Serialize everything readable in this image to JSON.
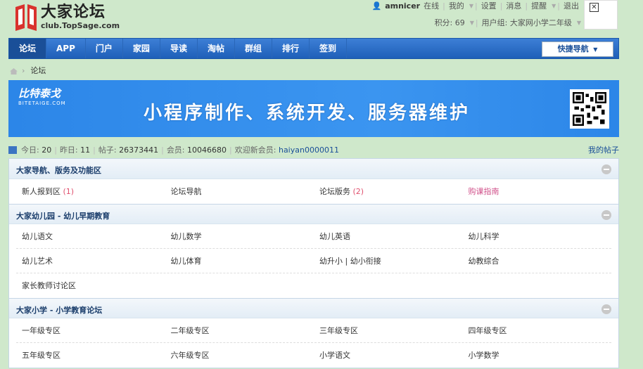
{
  "logo": {
    "title": "大家论坛",
    "subtitle": "club.TopSage.com",
    "color": "#d9322d"
  },
  "user": {
    "name": "amnicer",
    "status": "在线",
    "menu": [
      "我的",
      "设置",
      "消息",
      "提醒",
      "退出"
    ],
    "points_label": "积分: 69",
    "group_label": "用户组: 大家网小学二年级"
  },
  "nav": {
    "items": [
      "论坛",
      "APP",
      "门户",
      "家园",
      "导读",
      "淘帖",
      "群组",
      "排行",
      "签到"
    ],
    "quick_nav": "快捷导航"
  },
  "breadcrumb": {
    "current": "论坛"
  },
  "banner": {
    "logo_text": "比特泰戈",
    "logo_sub": "BITETAIGE.COM",
    "slogan": "小程序制作、系统开发、服务器维护"
  },
  "stats": {
    "today_label": "今日:",
    "today": "20",
    "yesterday_label": "昨日:",
    "yesterday": "11",
    "posts_label": "帖子:",
    "posts": "26373441",
    "members_label": "会员:",
    "members": "10046680",
    "welcome_label": "欢迎新会员:",
    "newest_member": "haiyan0000011",
    "my_posts": "我的帖子"
  },
  "categories": [
    {
      "title": "大家导航、版务及功能区",
      "rows": [
        [
          {
            "name": "新人报到区",
            "count": "(1)"
          },
          {
            "name": "论坛导航",
            "count": ""
          },
          {
            "name": "论坛版务",
            "count": "(2)"
          },
          {
            "name": "购课指南",
            "count": ""
          }
        ]
      ]
    },
    {
      "title": "大家幼儿园 - 幼儿早期教育",
      "rows": [
        [
          {
            "name": "幼儿语文",
            "count": ""
          },
          {
            "name": "幼儿数学",
            "count": ""
          },
          {
            "name": "幼儿英语",
            "count": ""
          },
          {
            "name": "幼儿科学",
            "count": ""
          }
        ],
        [
          {
            "name": "幼儿艺术",
            "count": ""
          },
          {
            "name": "幼儿体育",
            "count": ""
          },
          {
            "name": "幼升小 | 幼小衔接",
            "count": ""
          },
          {
            "name": "幼教综合",
            "count": ""
          }
        ],
        [
          {
            "name": "家长教师讨论区",
            "count": ""
          }
        ]
      ]
    },
    {
      "title": "大家小学 - 小学教育论坛",
      "rows": [
        [
          {
            "name": "一年级专区",
            "count": ""
          },
          {
            "name": "二年级专区",
            "count": ""
          },
          {
            "name": "三年级专区",
            "count": ""
          },
          {
            "name": "四年级专区",
            "count": ""
          }
        ],
        [
          {
            "name": "五年级专区",
            "count": ""
          },
          {
            "name": "六年级专区",
            "count": ""
          },
          {
            "name": "小学语文",
            "count": ""
          },
          {
            "name": "小学数学",
            "count": ""
          }
        ]
      ]
    }
  ]
}
